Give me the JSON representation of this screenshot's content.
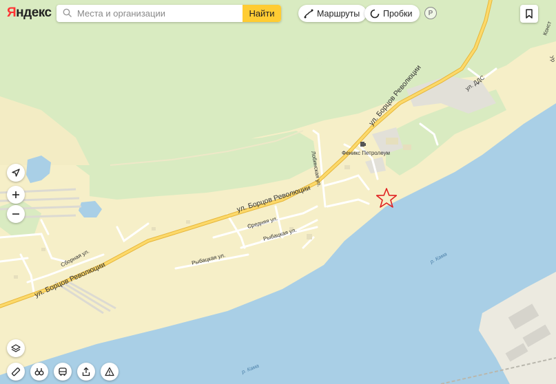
{
  "header": {
    "logo": "Яндекс",
    "search_placeholder": "Места и организации",
    "search_button": "Найти",
    "routes_label": "Маршруты",
    "traffic_label": "Пробки",
    "parking_letter": "P"
  },
  "map": {
    "street_main_1": "ул. Борцов Революции",
    "street_main_2": "ул. Борцов Революции",
    "street_main_3": "ул. Борцов Революции",
    "street_dds": "ул. ДДС",
    "street_lobinskaya": "Лобинская ул.",
    "street_srednyaya": "Средняя ул.",
    "street_rybatskaya_1": "Рыбацкая ул.",
    "street_rybatskaya_2": "Рыбацкая ул.",
    "street_sbornaya": "Сборная ул.",
    "poi_feniks": "Феникс Петролеум",
    "river_1": "р. Кама",
    "river_2": "р. Кама",
    "edge_label_1": "Конст",
    "edge_label_2": "Ур"
  },
  "colors": {
    "land": "#f6efc8",
    "forest": "#d9ebc1",
    "water": "#a9cfe6",
    "road": "#fcd96a",
    "marker": "#e02020"
  },
  "icons": {
    "search": "search-icon",
    "routes": "routes-icon",
    "traffic": "traffic-icon",
    "bookmark": "bookmark-icon",
    "locate": "locate-arrow-icon",
    "zoom_in": "plus-icon",
    "zoom_out": "minus-icon",
    "layers": "layers-icon",
    "ruler": "ruler-icon",
    "panorama": "binoculars-icon",
    "transport": "bus-icon",
    "share": "share-icon",
    "report": "warning-icon",
    "marker": "star-marker-icon"
  }
}
